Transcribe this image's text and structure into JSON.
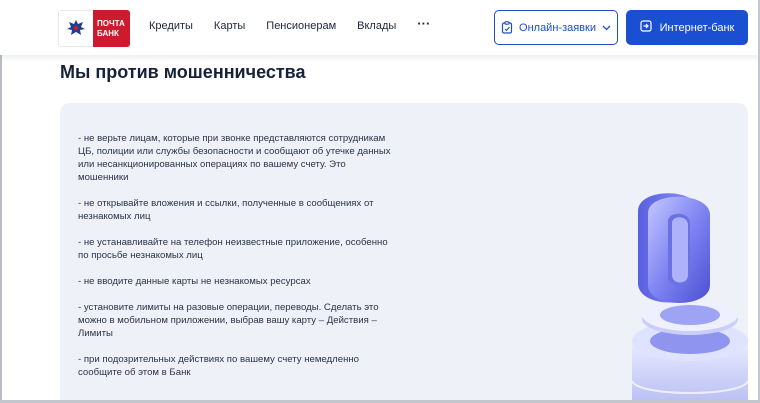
{
  "header": {
    "logo": {
      "line1": "ПОЧТА",
      "line2": "БАНК",
      "emblem_icon": "eagle-emblem-icon"
    },
    "nav": [
      {
        "label": "Кредиты"
      },
      {
        "label": "Карты"
      },
      {
        "label": "Пенсионерам"
      },
      {
        "label": "Вклады"
      }
    ],
    "more_label": "···",
    "online_button": {
      "label": "Онлайн-заявки",
      "icon": "clipboard-icon",
      "chevron": "chevron-down-icon"
    },
    "bank_button": {
      "label": "Интернет-банк",
      "icon": "login-icon"
    }
  },
  "main": {
    "title": "Мы против мошенничества",
    "tips": [
      "- не верьте лицам, которые при звонке представляются сотрудникам ЦБ, полиции или службы безопасности и сообщают об утечке данных или несанкционированных операциях по вашему счету. Это мошенники",
      "- не открывайте вложения и ссылки, полученные в сообщениях от незнакомых лиц",
      "- не устанавливайте на телефон неизвестные приложение, особенно по просьбе незнакомых лиц",
      "- не вводите данные карты не незнакомых ресурсах",
      "- установите лимиты на разовые операции, переводы. Сделать это можно в мобильном приложении, выбрав вашу карту – Действия – Лимиты",
      "- при подозрительных действиях по вашему счету немедленно сообщите об этом в Банк"
    ],
    "illustration": "zero-3d-illustration"
  },
  "colors": {
    "brand_red": "#ce1a2f",
    "brand_blue": "#1a4fd1",
    "card_background": "#eef1f8",
    "title_text": "#16213a"
  }
}
